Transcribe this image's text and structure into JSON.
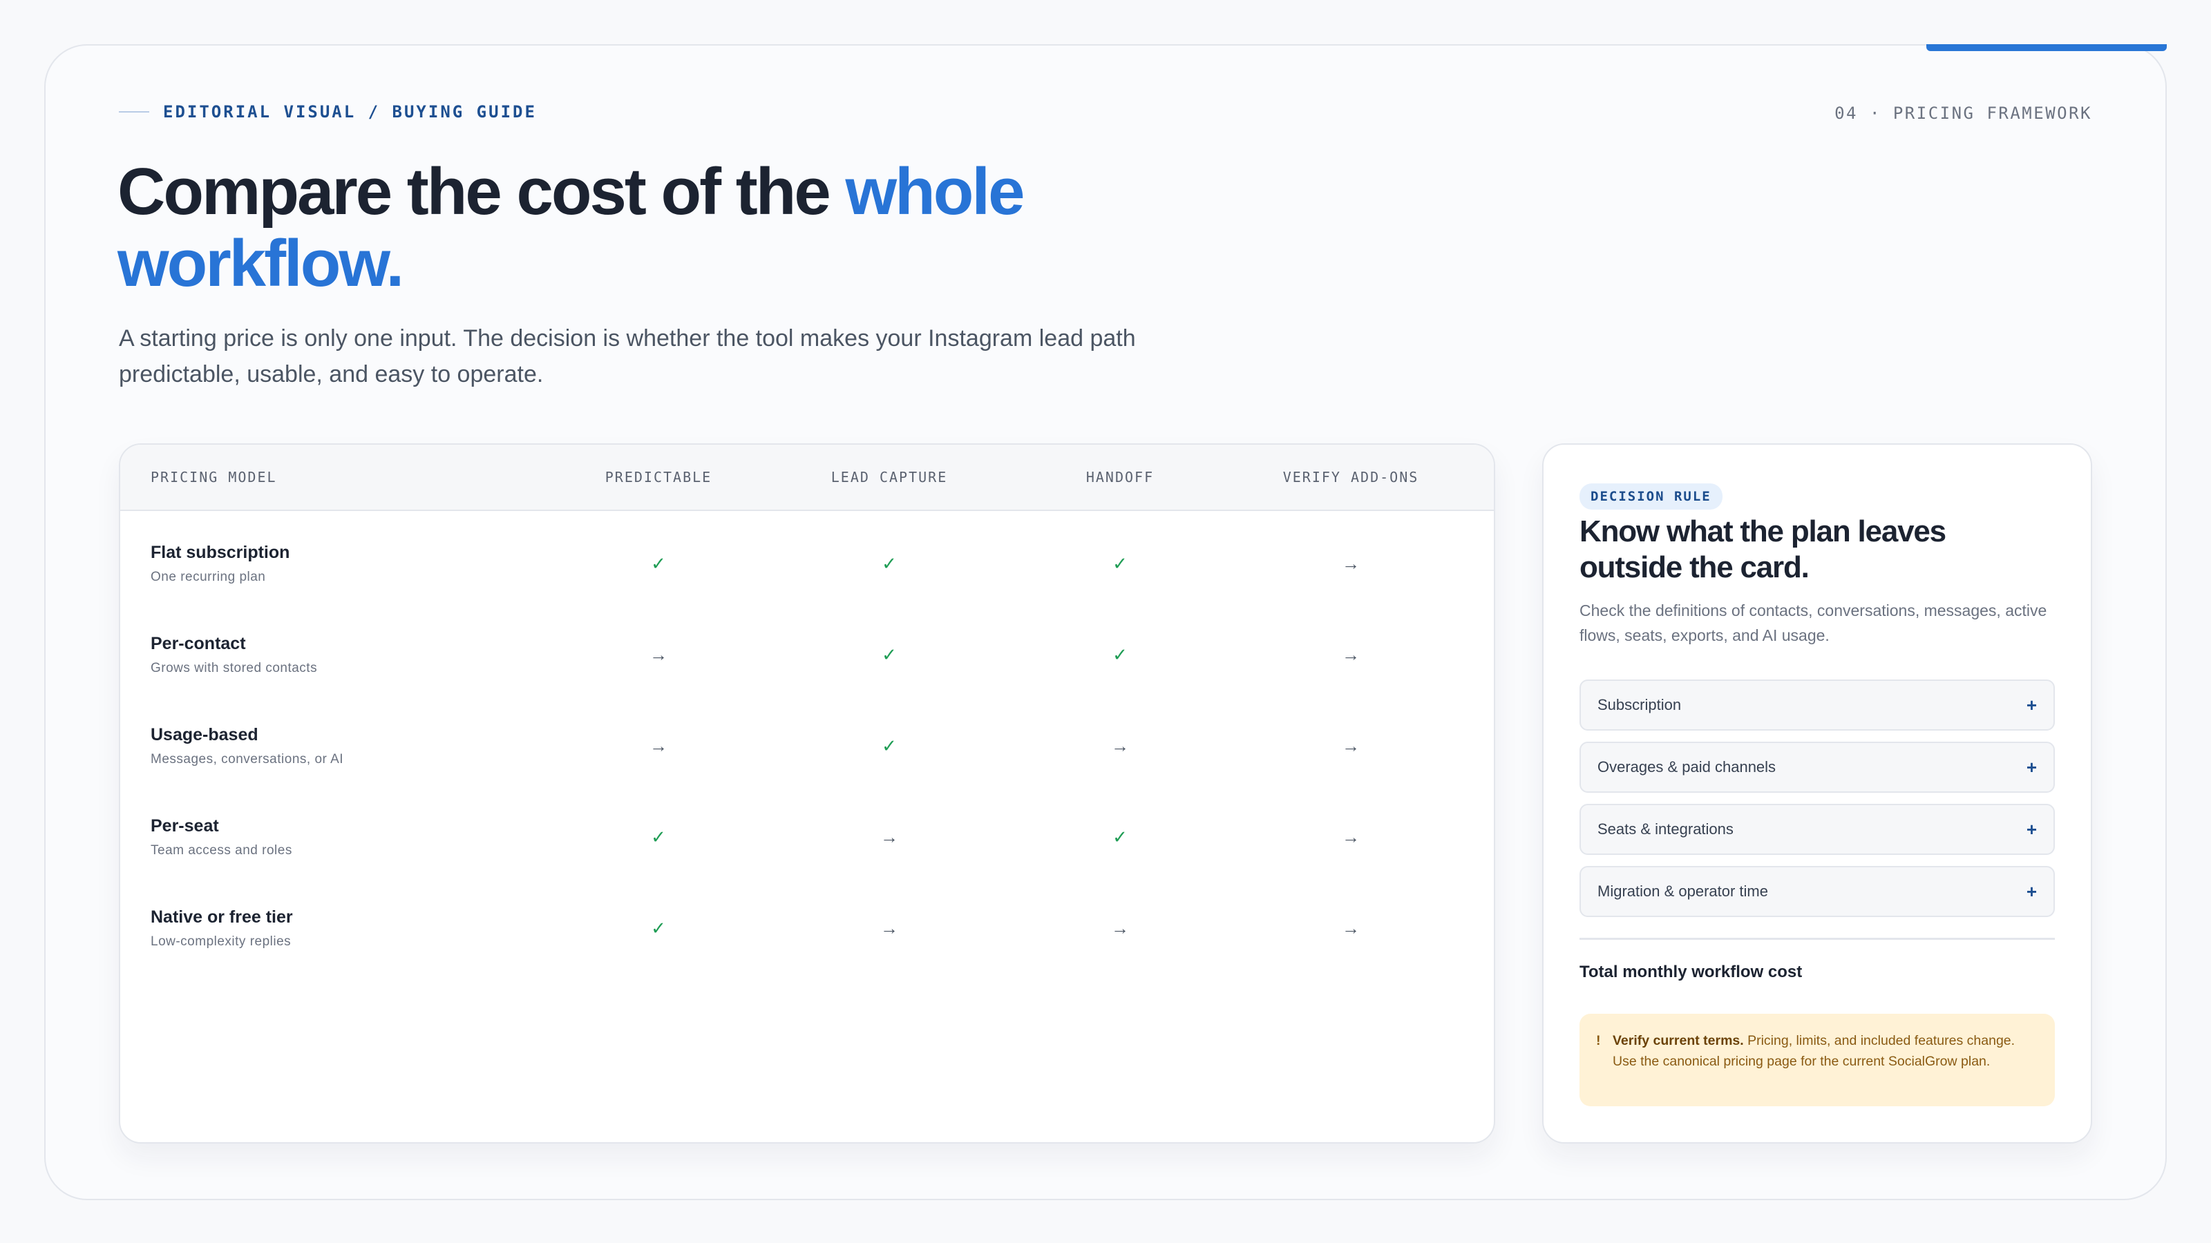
{
  "header": {
    "eyebrow": "EDITORIAL VISUAL / BUYING GUIDE",
    "section": "04 · PRICING FRAMEWORK",
    "headline_part1": "Compare the cost of the ",
    "headline_highlight": "whole workflow.",
    "lede": "A starting price is only one input. The decision is whether the tool makes your Instagram lead path predictable, usable, and easy to operate."
  },
  "table": {
    "columns": [
      "PRICING MODEL",
      "PREDICTABLE",
      "LEAD CAPTURE",
      "HANDOFF",
      "VERIFY ADD-ONS"
    ],
    "rows": [
      {
        "name": "Flat subscription",
        "sub": "One recurring plan",
        "marks": [
          "✓",
          "✓",
          "✓",
          "→"
        ]
      },
      {
        "name": "Per-contact",
        "sub": "Grows with stored contacts",
        "marks": [
          "→",
          "✓",
          "✓",
          "→"
        ]
      },
      {
        "name": "Usage-based",
        "sub": "Messages, conversations, or AI",
        "marks": [
          "→",
          "✓",
          "→",
          "→"
        ]
      },
      {
        "name": "Per-seat",
        "sub": "Team access and roles",
        "marks": [
          "✓",
          "→",
          "✓",
          "→"
        ]
      },
      {
        "name": "Native or free tier",
        "sub": "Low-complexity replies",
        "marks": [
          "✓",
          "→",
          "→",
          "→"
        ]
      }
    ]
  },
  "side": {
    "badge": "DECISION RULE",
    "title": "Know what the plan leaves outside the card.",
    "description": "Check the definitions of contacts, conversations, messages, active flows, seats, exports, and AI usage.",
    "accordion": [
      {
        "label": "Subscription",
        "icon": "+"
      },
      {
        "label": "Overages & paid channels",
        "icon": "+"
      },
      {
        "label": "Seats & integrations",
        "icon": "+"
      },
      {
        "label": "Migration & operator time",
        "icon": "+"
      }
    ],
    "total_label": "Total monthly workflow cost",
    "note_icon": "!",
    "note_strong": "Verify current terms.",
    "note_text": " Pricing, limits, and included features change. Use the canonical pricing page for the current SocialGrow plan."
  },
  "colors": {
    "accent": "#2874d6",
    "check": "#1f9d55",
    "note_bg": "#fff2d6"
  }
}
